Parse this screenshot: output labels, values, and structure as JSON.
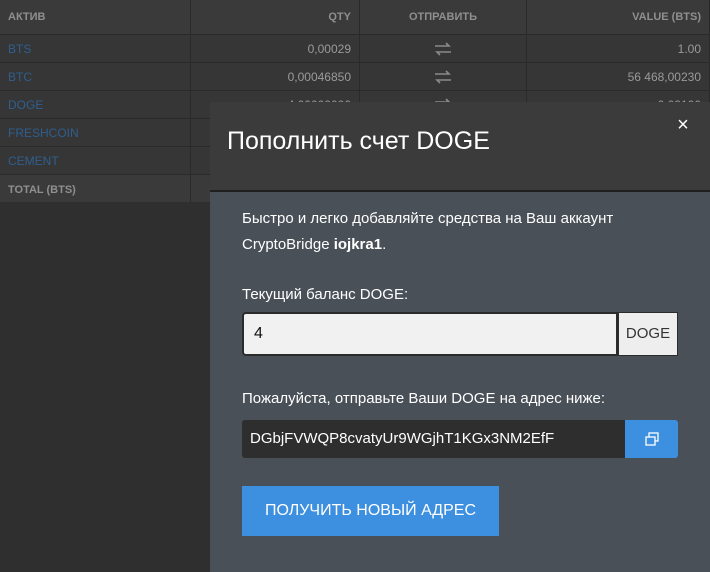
{
  "table": {
    "headers": {
      "asset": "АКТИВ",
      "qty": "QTY",
      "send": "ОТПРАВИТЬ",
      "value": "VALUE (BTS)"
    },
    "rows": [
      {
        "asset": "BTS",
        "qty": "0,00029",
        "value": "1.00"
      },
      {
        "asset": "BTC",
        "qty": "0,00046850",
        "value": "56 468,00230"
      },
      {
        "asset": "DOGE",
        "qty": "4,00000000",
        "value": "0,02100"
      },
      {
        "asset": "FRESHCOIN",
        "qty": "",
        "value": ""
      },
      {
        "asset": "CEMENT",
        "qty": "",
        "value": ""
      }
    ],
    "total_label": "TOTAL (BTS)",
    "send_icon": "transfer-arrows-icon"
  },
  "modal": {
    "title": "Пополнить счет DOGE",
    "close_icon": "×",
    "intro_prefix": "Быстро и легко добавляйте средства на Ваш аккаунт CryptoBridge ",
    "account_name": "iojkra1",
    "intro_suffix": ".",
    "balance_label": "Текущий баланс DOGE:",
    "balance_value": "4",
    "balance_unit": "DOGE",
    "address_label": "Пожалуйста, отправьте Ваши DOGE на адрес ниже:",
    "address": "DGbjFVWQP8cvatyUr9WGjhT1KGx3NM2EfF",
    "copy_icon": "copy-icon",
    "new_address_button": "ПОЛУЧИТЬ НОВЫЙ АДРЕС"
  },
  "colors": {
    "accent": "#3d8fe0",
    "asset_link": "#2f5f8f",
    "modal_bg": "#495057",
    "header_bg": "#3b3b3b"
  }
}
